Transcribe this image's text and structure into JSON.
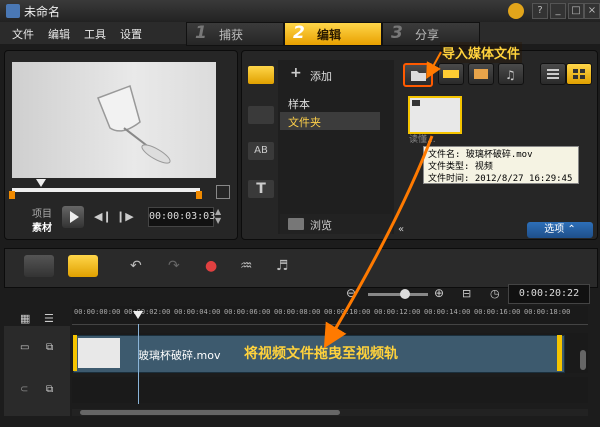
{
  "window": {
    "title": "未命名"
  },
  "menu": [
    "文件",
    "编辑",
    "工具",
    "设置"
  ],
  "steps": [
    {
      "num": "1",
      "label": "捕获"
    },
    {
      "num": "2",
      "label": "编辑"
    },
    {
      "num": "3",
      "label": "分享"
    }
  ],
  "preview": {
    "mode_project": "项目",
    "mode_clip": "素材",
    "timecode": "00:00:03:03"
  },
  "library": {
    "add_label": "添加",
    "list_items": [
      "样本",
      "文件夹"
    ],
    "browse_label": "浏览",
    "thumb_caption": "读懂...",
    "tooltip": {
      "line1": "文件名: 玻璃杯破碎.mov",
      "line2": "文件类型: 视频",
      "line3": "文件时间: 2012/8/27 16:29:45"
    },
    "options_label": "选项",
    "import_callout": "导入媒体文件"
  },
  "timeline": {
    "duration": "0:00:20:22",
    "ruler": [
      "00:00:00:00",
      "00:00:02:00",
      "00:00:04:00",
      "00:00:06:00",
      "00:00:08:00",
      "00:00:10:00",
      "00:00:12:00",
      "00:00:14:00",
      "00:00:16:00",
      "00:00:18:00"
    ],
    "clip_name": "玻璃杯破碎.mov",
    "drag_callout": "将视频文件拖曳至视频轨"
  }
}
